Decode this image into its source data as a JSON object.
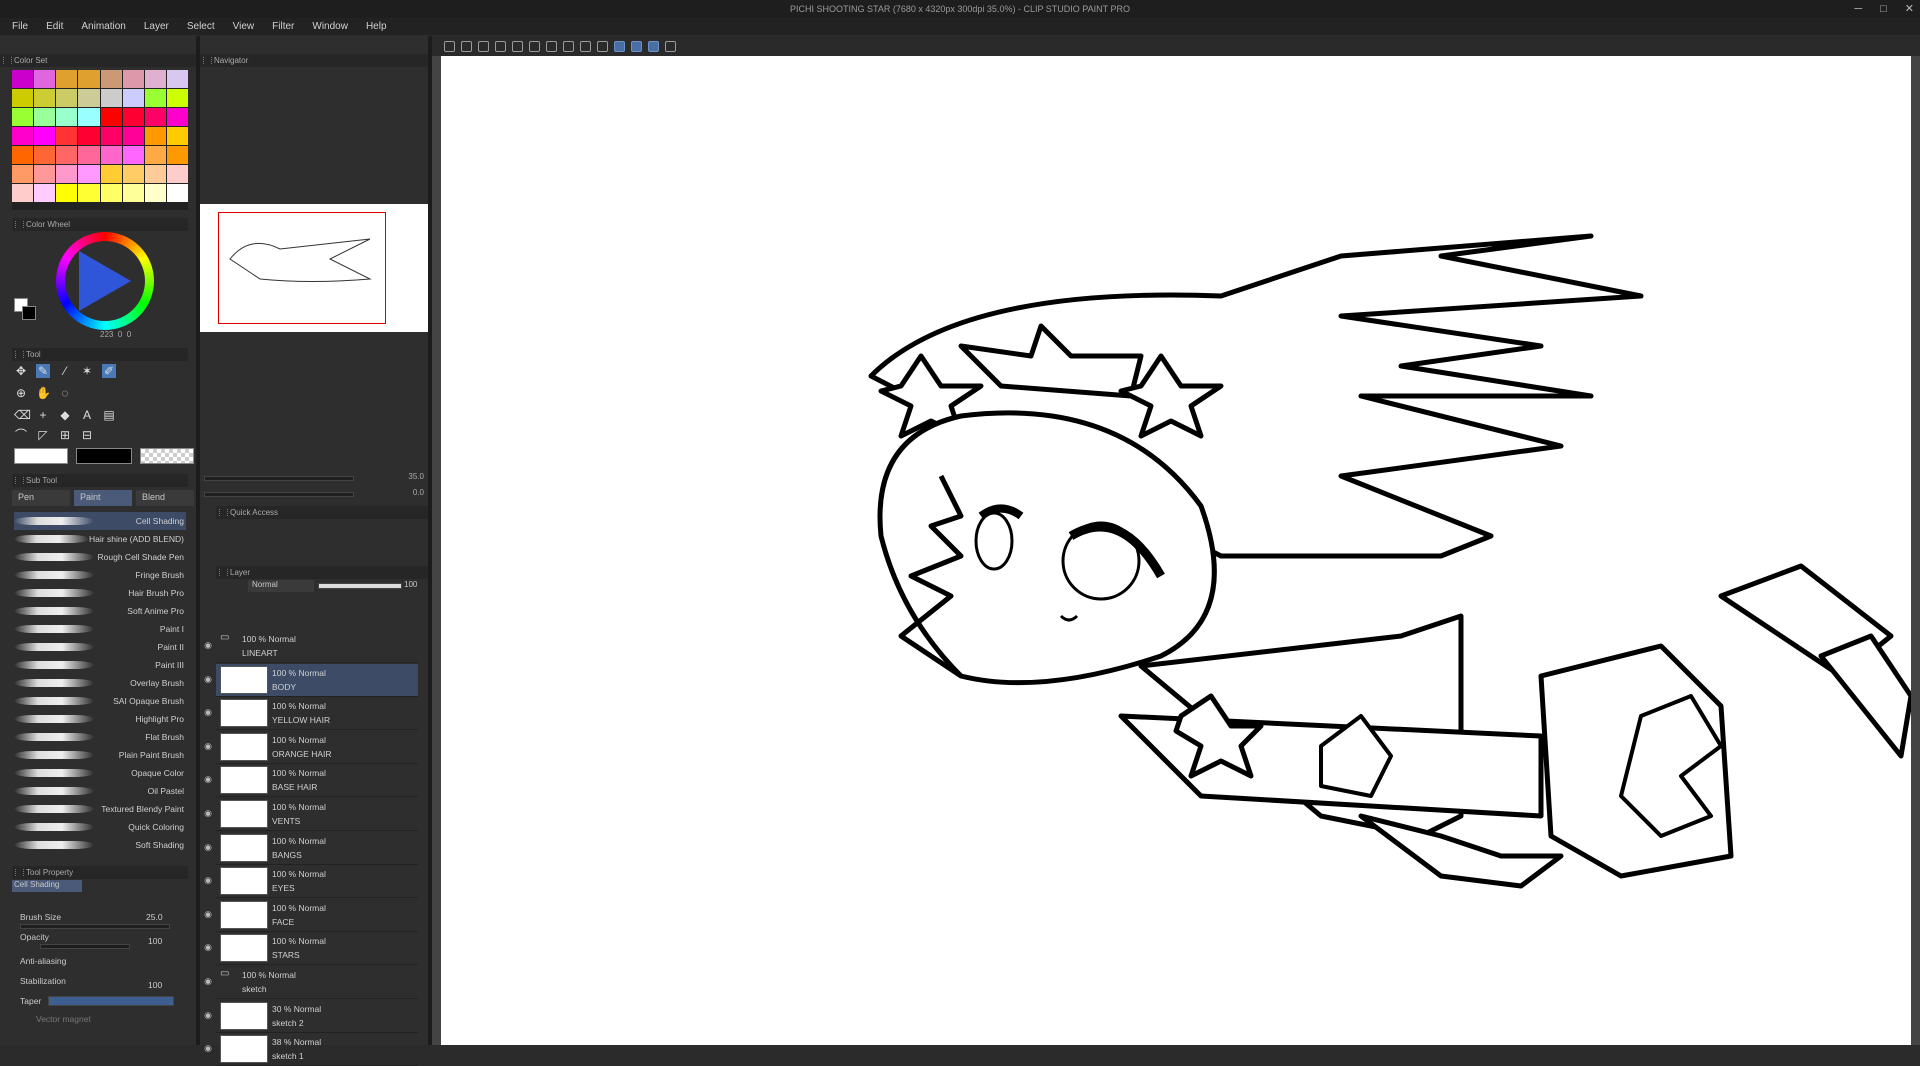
{
  "window": {
    "title": "PICHI SHOOTING STAR (7680 x 4320px 300dpi 35.0%)  - CLIP STUDIO PAINT PRO",
    "controls": [
      "─",
      "□",
      "✕"
    ]
  },
  "menu": [
    "File",
    "Edit",
    "Animation",
    "Layer",
    "Select",
    "View",
    "Filter",
    "Window",
    "Help"
  ],
  "panels": {
    "color_set": "Color Set",
    "color_wheel": "Color Wheel",
    "navigator": "Navigator",
    "tool": "Tool",
    "sub_tool": "Sub Tool",
    "quick_access": "Quick Access",
    "layer": "Layer",
    "tool_property": "Tool Property",
    "brush_size_tab": "Brush Size"
  },
  "colors": {
    "swatches": [
      "#c0c",
      "#e066e0",
      "#e0a030",
      "#e0a030",
      "#c97",
      "#d9a",
      "#e0b0d0",
      "#d8c8f0",
      "#cc0",
      "#cc3",
      "#cc6",
      "#cc9",
      "#ccc",
      "#ccf",
      "#9f3",
      "#cf0",
      "#9f3",
      "#9f9",
      "#9fc",
      "#9ff",
      "#f00",
      "#f03",
      "#f06",
      "#f0c",
      "#f0c",
      "#f0f",
      "#f33",
      "#f03",
      "#f06",
      "#f09",
      "#f90",
      "#fc0",
      "#f60",
      "#f63",
      "#f66",
      "#f69",
      "#f6c",
      "#f6f",
      "#fa4",
      "#f90",
      "#f96",
      "#f99",
      "#f9c",
      "#f9f",
      "#fc3",
      "#fc6",
      "#fc9",
      "#fcc",
      "#fcc",
      "#fcf",
      "#ff0",
      "#ff3",
      "#ff6",
      "#ff9",
      "#ffc",
      "#fff"
    ],
    "accent": "#4a79b7"
  },
  "wheel_readout": {
    "h": "223",
    "s": "0",
    "v": "0"
  },
  "subtool_tabs": [
    "Pen",
    "Paint",
    "Blend"
  ],
  "brushes": [
    "Cell Shading",
    "Hair shine (ADD BLEND)",
    "Rough Cell Shade Pen",
    "Fringe Brush",
    "Hair Brush Pro",
    "Soft Anime Pro",
    "Paint I",
    "Paint II",
    "Paint III",
    "Overlay Brush",
    "SAI Opaque Brush",
    "Highlight Pro",
    "Flat Brush",
    "Plain Paint Brush",
    "Opaque Color",
    "Oil Pastel",
    "Textured Blendy Paint",
    "Quick Coloring",
    "Soft Shading"
  ],
  "navigator": {
    "zoom": "35.0",
    "rotate": "0.0"
  },
  "layer_panel": {
    "blend_mode": "Normal",
    "opacity": "100"
  },
  "layers": [
    {
      "mode": "100 % Normal",
      "name": "LINEART",
      "folder": true
    },
    {
      "mode": "100 % Normal",
      "name": "BODY",
      "selected": true
    },
    {
      "mode": "100 % Normal",
      "name": "YELLOW HAIR"
    },
    {
      "mode": "100 % Normal",
      "name": "ORANGE HAIR"
    },
    {
      "mode": "100 % Normal",
      "name": "BASE HAIR"
    },
    {
      "mode": "100 % Normal",
      "name": "VENTS"
    },
    {
      "mode": "100 % Normal",
      "name": "BANGS"
    },
    {
      "mode": "100 % Normal",
      "name": "EYES"
    },
    {
      "mode": "100 % Normal",
      "name": "FACE"
    },
    {
      "mode": "100 % Normal",
      "name": "STARS"
    },
    {
      "mode": "100 % Normal",
      "name": "sketch",
      "folder": true
    },
    {
      "mode": "30 % Normal",
      "name": "sketch 2"
    },
    {
      "mode": "38 % Normal",
      "name": "sketch 1"
    }
  ],
  "tool_property": {
    "brush": "Cell Shading",
    "brush_size_label": "Brush Size",
    "brush_size": "25.0",
    "opacity_label": "Opacity",
    "opacity": "100",
    "aa_label": "Anti-aliasing",
    "stab_label": "Stabilization",
    "stab": "100",
    "taper_label": "Taper",
    "vector_label": "Vector magnet"
  }
}
